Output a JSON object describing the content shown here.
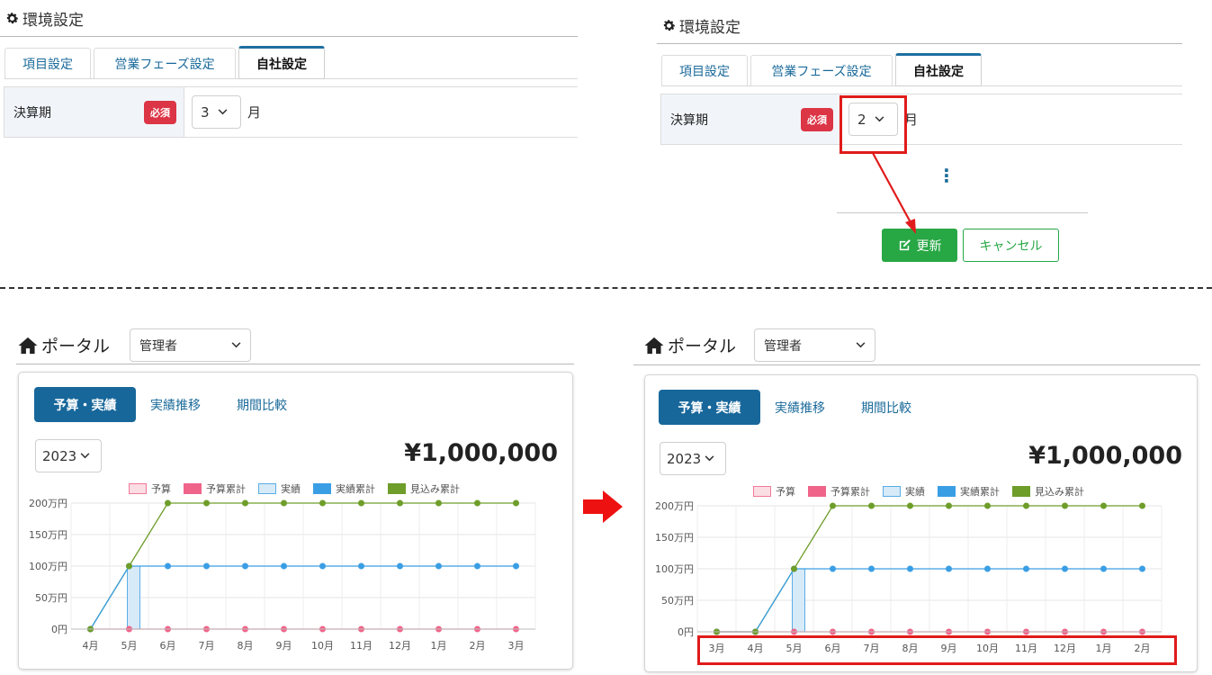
{
  "settings": {
    "title": "環境設定",
    "tabs": [
      "項目設定",
      "営業フェーズ設定",
      "自社設定"
    ],
    "active_tab": "自社設定",
    "field_label": "決算期",
    "required_badge": "必須",
    "unit": "月",
    "before_value": "3",
    "after_value": "2",
    "ellipsis": "⋮",
    "update_button": "更新",
    "cancel_button": "キャンセル"
  },
  "portal": {
    "title": "ポータル",
    "role": "管理者",
    "tabs": [
      "予算・実績",
      "実績推移",
      "期間比較"
    ],
    "year": "2023",
    "amount": "¥1,000,000"
  },
  "colors": {
    "budget": "#f7c8d3",
    "budget_cum": "#f0648a",
    "actual": "#cfe6f7",
    "actual_cum": "#3a9ee4",
    "forecast_cum": "#6e9d2a",
    "accent_red": "#e01b1b",
    "tab_blue": "#17679b",
    "green_button": "#28a745"
  },
  "chart_data": [
    {
      "type": "bar",
      "categories": [
        "4月",
        "5月",
        "6月",
        "7月",
        "8月",
        "9月",
        "10月",
        "11月",
        "12月",
        "1月",
        "2月",
        "3月"
      ],
      "y_tick_labels": [
        "200万円",
        "150万円",
        "100万円",
        "50万円",
        "0円"
      ],
      "ylim": [
        0,
        2000000
      ],
      "legend": [
        "予算",
        "予算累計",
        "実績",
        "実績累計",
        "見込み累計"
      ],
      "series": [
        {
          "name": "予算",
          "type": "bar",
          "values": [
            0,
            0,
            0,
            0,
            0,
            0,
            0,
            0,
            0,
            0,
            0,
            0
          ]
        },
        {
          "name": "予算累計",
          "type": "line",
          "values": [
            0,
            0,
            0,
            0,
            0,
            0,
            0,
            0,
            0,
            0,
            0,
            0
          ]
        },
        {
          "name": "実績",
          "type": "bar",
          "values": [
            0,
            1000000,
            0,
            0,
            0,
            0,
            0,
            0,
            0,
            0,
            0,
            0
          ]
        },
        {
          "name": "実績累計",
          "type": "line",
          "values": [
            0,
            1000000,
            1000000,
            1000000,
            1000000,
            1000000,
            1000000,
            1000000,
            1000000,
            1000000,
            1000000,
            1000000
          ]
        },
        {
          "name": "見込み累計",
          "type": "line",
          "values": [
            0,
            1000000,
            2000000,
            2000000,
            2000000,
            2000000,
            2000000,
            2000000,
            2000000,
            2000000,
            2000000,
            2000000
          ]
        }
      ]
    },
    {
      "type": "bar",
      "categories": [
        "3月",
        "4月",
        "5月",
        "6月",
        "7月",
        "8月",
        "9月",
        "10月",
        "11月",
        "12月",
        "1月",
        "2月"
      ],
      "y_tick_labels": [
        "200万円",
        "150万円",
        "100万円",
        "50万円",
        "0円"
      ],
      "ylim": [
        0,
        2000000
      ],
      "legend": [
        "予算",
        "予算累計",
        "実績",
        "実績累計",
        "見込み累計"
      ],
      "series": [
        {
          "name": "予算",
          "type": "bar",
          "values": [
            0,
            0,
            0,
            0,
            0,
            0,
            0,
            0,
            0,
            0,
            0,
            0
          ]
        },
        {
          "name": "予算累計",
          "type": "line",
          "values": [
            0,
            0,
            0,
            0,
            0,
            0,
            0,
            0,
            0,
            0,
            0,
            0
          ]
        },
        {
          "name": "実績",
          "type": "bar",
          "values": [
            0,
            0,
            1000000,
            0,
            0,
            0,
            0,
            0,
            0,
            0,
            0,
            0
          ]
        },
        {
          "name": "実績累計",
          "type": "line",
          "values": [
            0,
            0,
            1000000,
            1000000,
            1000000,
            1000000,
            1000000,
            1000000,
            1000000,
            1000000,
            1000000,
            1000000
          ]
        },
        {
          "name": "見込み累計",
          "type": "line",
          "values": [
            0,
            0,
            1000000,
            2000000,
            2000000,
            2000000,
            2000000,
            2000000,
            2000000,
            2000000,
            2000000,
            2000000
          ]
        }
      ]
    }
  ]
}
